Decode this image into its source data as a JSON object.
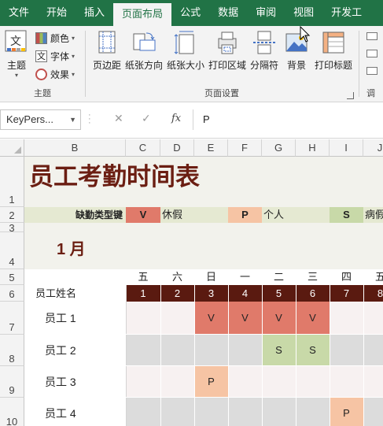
{
  "ribbon_tabs": [
    "文件",
    "开始",
    "插入",
    "页面布局",
    "公式",
    "数据",
    "审阅",
    "视图",
    "开发工"
  ],
  "active_tab_index": 3,
  "ribbon": {
    "theme_group": {
      "label": "主题",
      "theme_button": "主题",
      "colors_button": "颜色",
      "fonts_button": "字体",
      "effects_button": "效果",
      "theme_icon_text": "文"
    },
    "page_setup_group": {
      "label": "页面设置",
      "margins": "页边距",
      "orientation": "纸张方向",
      "size": "纸张大小",
      "print_area": "打印区域",
      "breaks": "分隔符",
      "background": "背景",
      "print_titles": "打印标题"
    },
    "partial_group": {
      "labels": [
        "调"
      ]
    }
  },
  "formula_bar": {
    "name_box": "KeyPers...",
    "formula_value": "P",
    "fx_label": "fx"
  },
  "sheet": {
    "columns": [
      "B",
      "C",
      "D",
      "E",
      "F",
      "G",
      "H",
      "I",
      "J"
    ],
    "rows": [
      "1",
      "2",
      "3",
      "4",
      "5",
      "6",
      "7",
      "8",
      "9",
      "10"
    ],
    "title": "员工考勤时间表",
    "key_label": "缺勤类型键",
    "legend": [
      {
        "code": "V",
        "desc": "休假",
        "color": "#e07a6a"
      },
      {
        "code": "P",
        "desc": "个人",
        "color": "#f6c4a4"
      },
      {
        "code": "S",
        "desc": "病假",
        "color": "#c8d9a8"
      }
    ],
    "month": "1 月",
    "weekdays": [
      "五",
      "六",
      "日",
      "一",
      "二",
      "三",
      "四",
      "五"
    ],
    "name_header": "员工姓名",
    "day_numbers": [
      "1",
      "2",
      "3",
      "4",
      "5",
      "6",
      "7",
      "8"
    ],
    "employees": [
      {
        "name": "员工 1",
        "marks": [
          "",
          "",
          "V",
          "V",
          "V",
          "V",
          "",
          ""
        ]
      },
      {
        "name": "员工 2",
        "marks": [
          "",
          "",
          "",
          "",
          "S",
          "S",
          "",
          ""
        ]
      },
      {
        "name": "员工 3",
        "marks": [
          "",
          "",
          "P",
          "",
          "",
          "",
          "",
          ""
        ]
      },
      {
        "name": "员工 4",
        "marks": [
          "",
          "",
          "",
          "",
          "",
          "",
          "P",
          ""
        ]
      }
    ]
  },
  "colors": {
    "accent": "#217346",
    "title_text": "#6b1e12",
    "header_band": "#5a1a10",
    "band_light": "#f2f2ec",
    "key_band": "#e5e9d2",
    "row_pink": "#f7f1f1",
    "row_gray": "#dcdcdc"
  }
}
